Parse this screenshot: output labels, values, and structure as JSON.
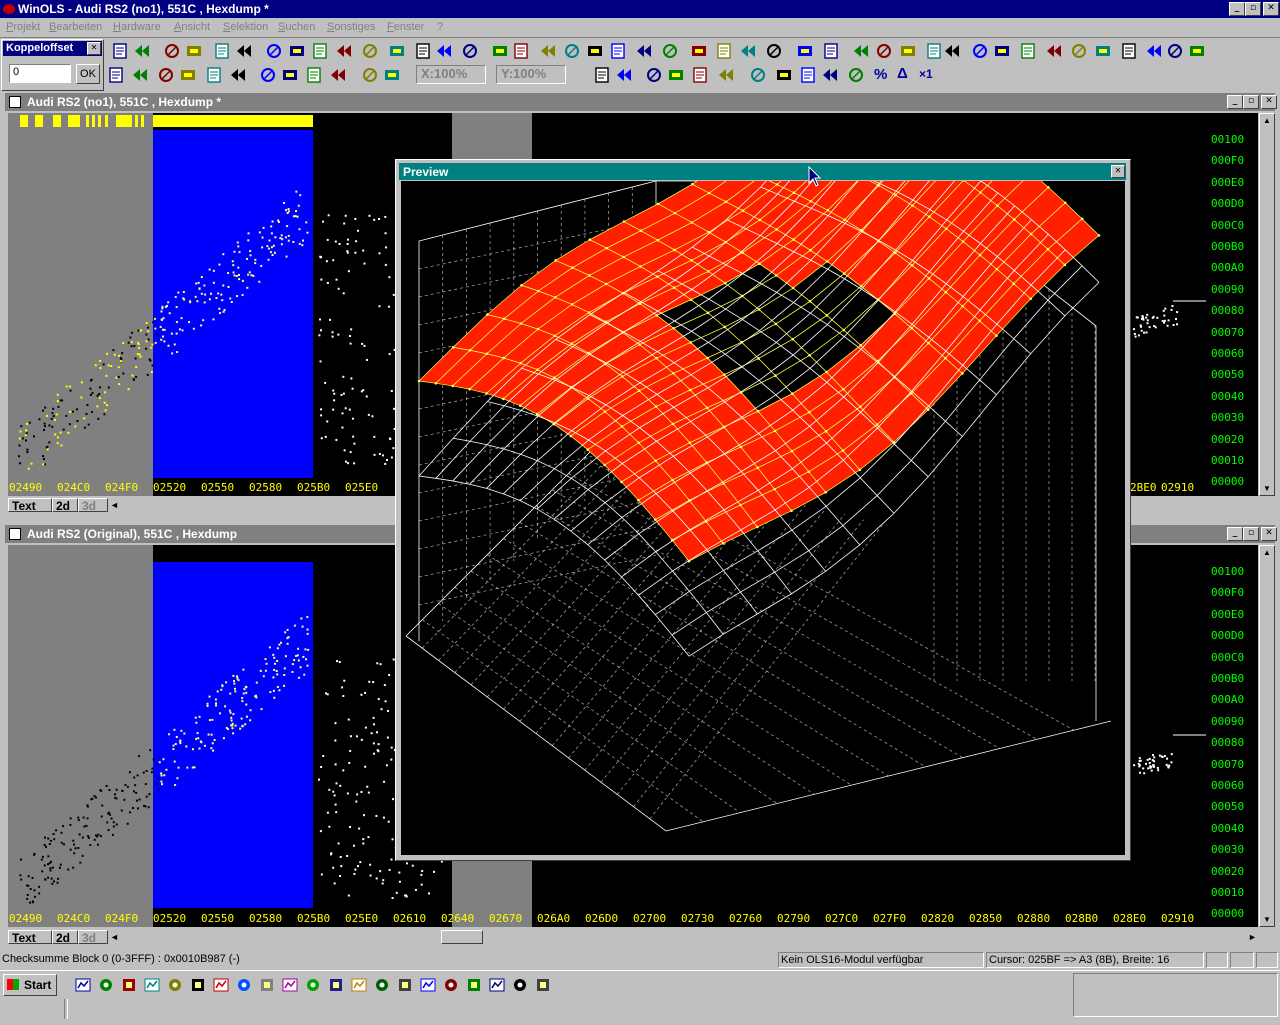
{
  "app": {
    "title": "WinOLS - Audi RS2 (no1), 551C , Hexdump *"
  },
  "window_controls": {
    "minimize": "_",
    "restore": "▫",
    "close": "✕"
  },
  "menu": [
    "Projekt",
    "Bearbeiten",
    "Hardware",
    "Ansicht",
    "Selektion",
    "Suchen",
    "Sonstiges",
    "Fenster",
    "?"
  ],
  "koppel": {
    "title": "Koppeloffset",
    "value": "0",
    "ok_label": "OK"
  },
  "toolbar": {
    "xzoom": "X:100%",
    "yzoom": "Y:100%",
    "percent": "%",
    "delta": "Δ",
    "times": "×1"
  },
  "top_window": {
    "title": "Audi RS2 (no1), 551C , Hexdump *"
  },
  "bottom_window": {
    "title": "Audi RS2 (Original), 551C , Hexdump"
  },
  "x_addresses": [
    "02490",
    "024C0",
    "024F0",
    "02520",
    "02550",
    "02580",
    "025B0",
    "025E0",
    "02610",
    "02640",
    "02670",
    "026A0",
    "026D0",
    "02700",
    "02730",
    "02760",
    "02790",
    "027C0",
    "027F0",
    "02820",
    "02850",
    "02880",
    "028B0",
    "028E0",
    "02910"
  ],
  "top_x_addresses_right": [
    "2BE0",
    "02910"
  ],
  "y_addresses": [
    "00100",
    "000F0",
    "000E0",
    "000D0",
    "000C0",
    "000B0",
    "000A0",
    "00090",
    "00080",
    "00070",
    "00060",
    "00050",
    "00040",
    "00030",
    "00020",
    "00010",
    "00000"
  ],
  "tabs": [
    "Text",
    "2d",
    "3d"
  ],
  "preview": {
    "title": "Preview"
  },
  "status": {
    "left": "Checksumme Block 0 (0-3FFF) : 0x0010B987 (-)",
    "middle": "Kein OLS16-Modul verfügbar",
    "right": "Cursor: 025BF => A3 (8B), Breite: 16"
  },
  "taskbar": {
    "start_label": "Start"
  },
  "colors": {
    "surface_fill": "#ff2000",
    "grid_line": "#ffff40",
    "highlight": "#0000ff",
    "address_text": "#ffff00",
    "axis_text": "#00ff00"
  }
}
